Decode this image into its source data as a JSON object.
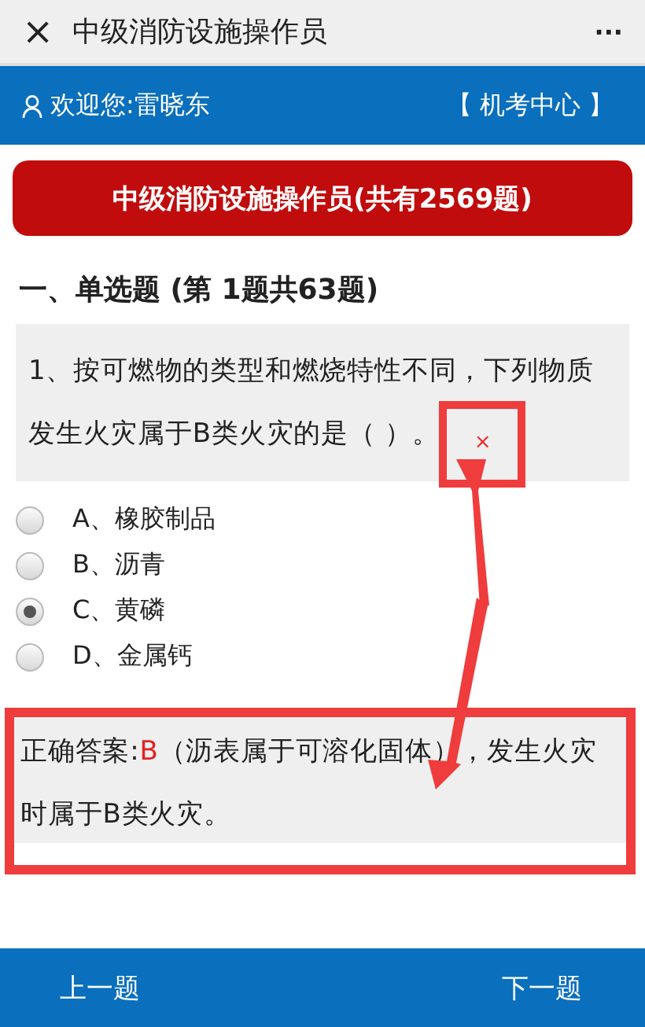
{
  "window": {
    "close": "×",
    "title": "中级消防设施操作员",
    "more": "···"
  },
  "header": {
    "welcome": "欢迎您:雷晓东",
    "link": "【 机考中心 】"
  },
  "banner": "中级消防设施操作员(共有2569题)",
  "section": "一、单选题 (第 1题共63题)",
  "question": {
    "text": "1、按可燃物的类型和燃烧特性不同，下列物质发生火灾属于B类火灾的是（ ）。",
    "mark": "×"
  },
  "options": [
    {
      "label": "A、橡胶制品",
      "selected": false
    },
    {
      "label": "B、沥青",
      "selected": false
    },
    {
      "label": "C、黄磷",
      "selected": true
    },
    {
      "label": "D、金属钙",
      "selected": false
    }
  ],
  "answer": {
    "label": "正确答案:",
    "letter": "B",
    "explanation": "（沥表属于可溶化固体），发生火灾时属于B类火灾。"
  },
  "footer": {
    "prev": "上一题",
    "next": "下一题"
  }
}
